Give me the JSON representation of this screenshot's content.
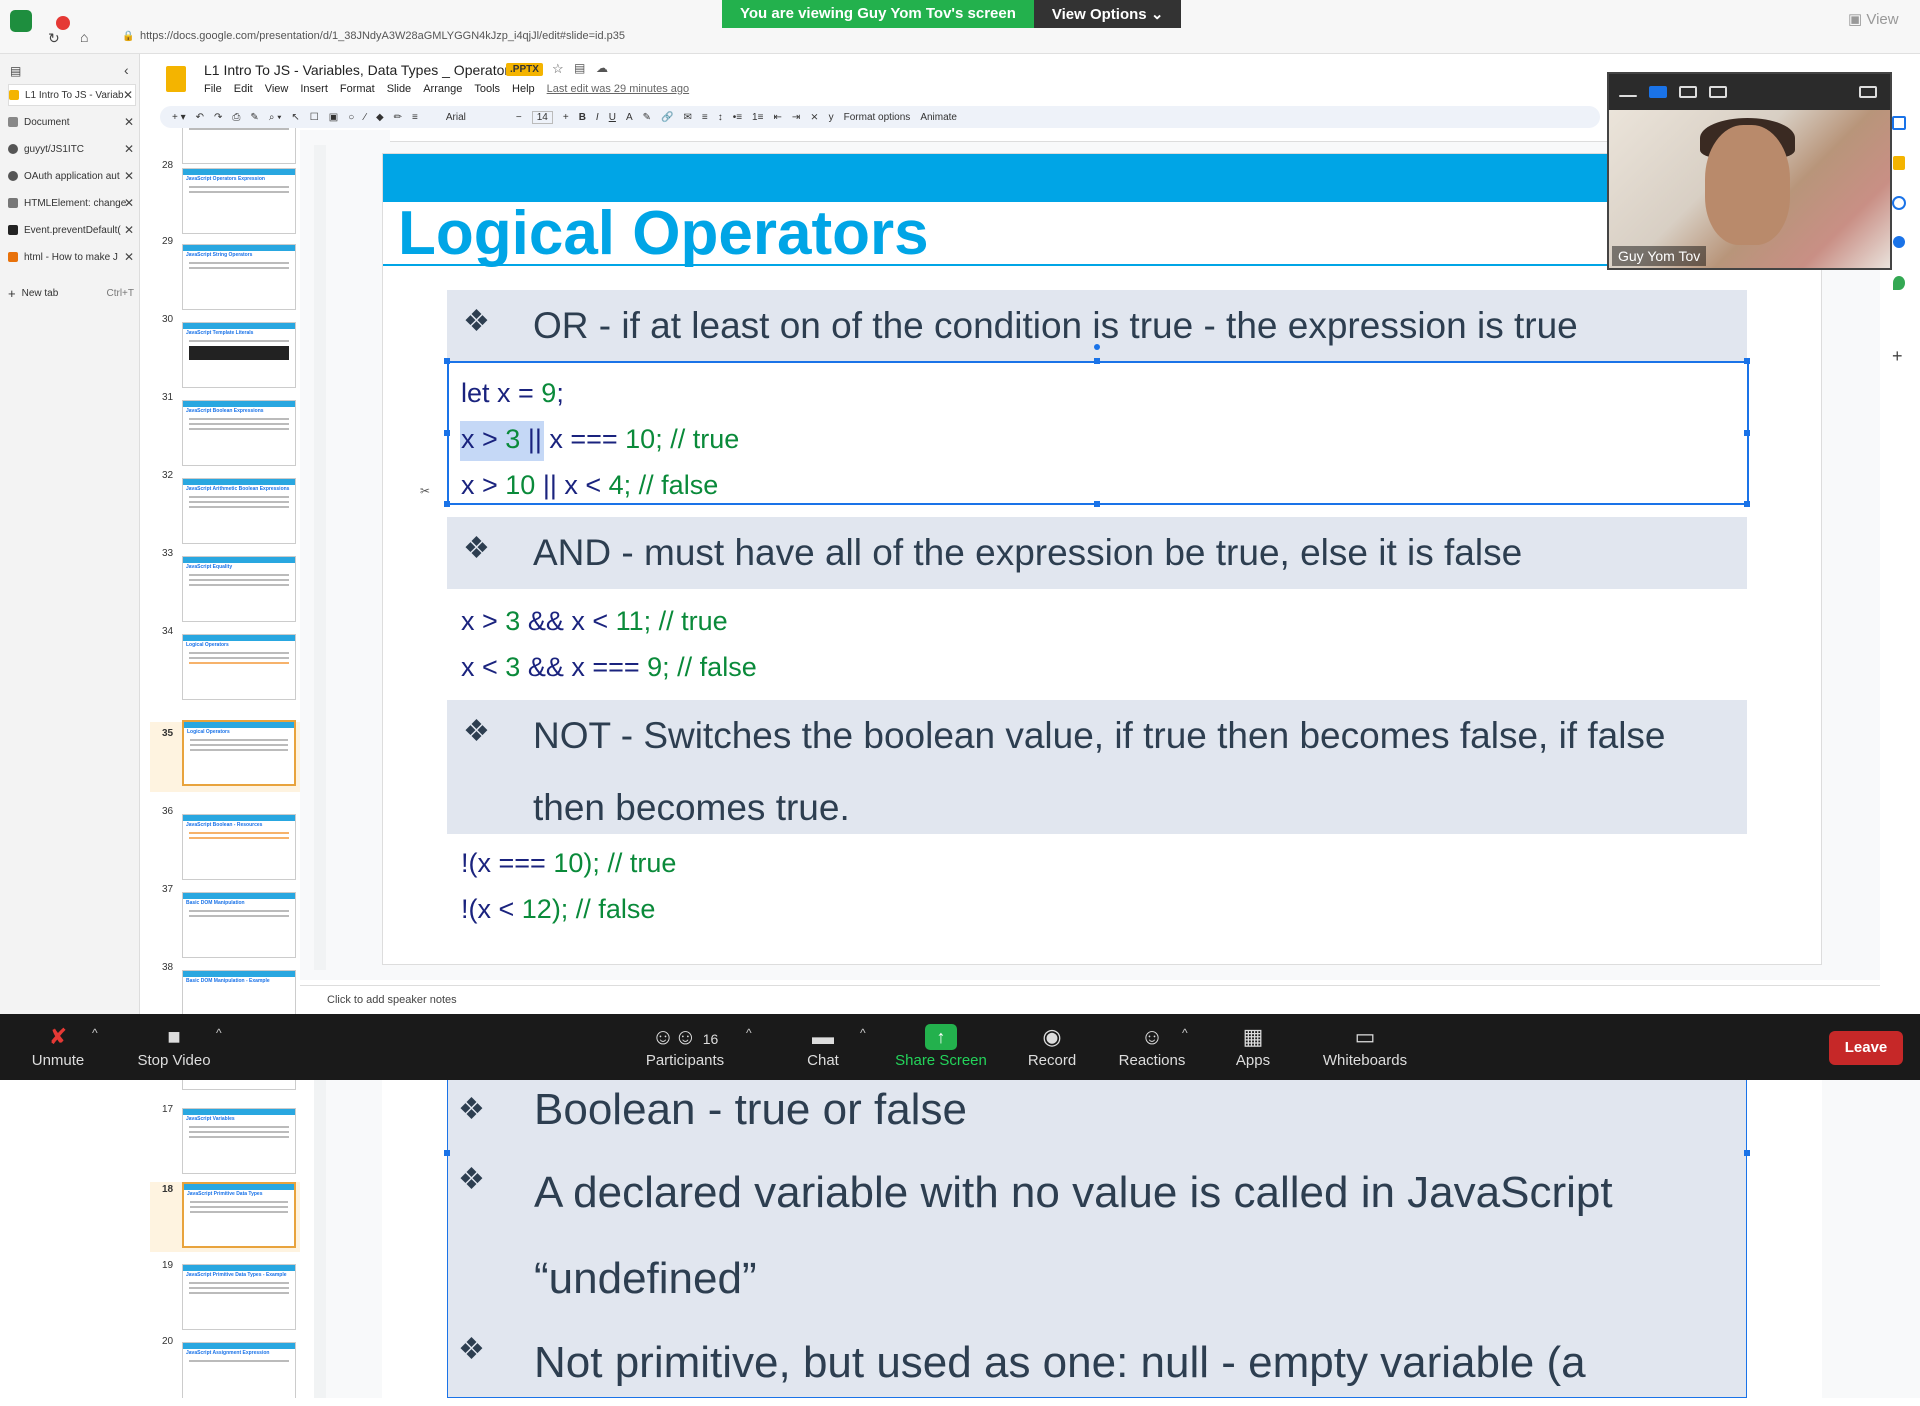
{
  "zoom_banner": {
    "viewing": "You are viewing Guy Yom Tov's screen",
    "view_options": "View Options"
  },
  "browser": {
    "url": "https://docs.google.com/presentation/d/1_38JNdyA3W28aGMLYGGN4kJzp_i4qjJl/edit#slide=id.p35",
    "tabs": [
      {
        "label": "L1 Intro To JS - Variab",
        "color": "#f4b400"
      },
      {
        "label": "Document",
        "color": "#888888"
      },
      {
        "label": "guyyt/JS1ITC",
        "color": "#555555"
      },
      {
        "label": "OAuth application aut",
        "color": "#555555"
      },
      {
        "label": "HTMLElement: change",
        "color": "#777777"
      },
      {
        "label": "Event.preventDefault(",
        "color": "#222222"
      },
      {
        "label": "html - How to make J",
        "color": "#e8710a"
      }
    ],
    "new_tab": "New tab",
    "new_tab_shortcut": "Ctrl+T",
    "view_label": "View"
  },
  "doc": {
    "title": "L1 Intro To JS - Variables, Data Types _ Operators",
    "badge": ".PPTX",
    "menu": [
      "File",
      "Edit",
      "View",
      "Insert",
      "Format",
      "Slide",
      "Arrange",
      "Tools",
      "Help"
    ],
    "last_edit": "Last edit was 29 minutes ago",
    "toolbar": {
      "font": "Arial",
      "size": "14",
      "format_options": "Format options",
      "animate": "Animate"
    }
  },
  "filmstrip": [
    {
      "num": "28",
      "title": "JavaScript Operators Expression"
    },
    {
      "num": "29",
      "title": "JavaScript String Operators"
    },
    {
      "num": "30",
      "title": "JavaScript Template Literals"
    },
    {
      "num": "31",
      "title": "JavaScript Boolean Expressions"
    },
    {
      "num": "32",
      "title": "JavaScript Arithmetic Boolean Expressions"
    },
    {
      "num": "33",
      "title": "JavaScript Equality"
    },
    {
      "num": "34",
      "title": "Logical Operators"
    },
    {
      "num": "35",
      "title": "Logical Operators"
    },
    {
      "num": "36",
      "title": "JavaScript Boolean - Resources"
    },
    {
      "num": "37",
      "title": "Basic DOM Manipulation"
    },
    {
      "num": "38",
      "title": "Basic DOM Manipulation - Example"
    }
  ],
  "slide": {
    "title": "Logical Operators",
    "or_bullet": "OR - if at least on of the condition is true - the expression is true",
    "and_bullet": "AND - must have all of the expression be true, else it is false",
    "not_bullet": "NOT - Switches the boolean value, if true then becomes false, if false then becomes true.",
    "code": {
      "l1": {
        "k": "let x = ",
        "n": "9",
        "p": ";"
      },
      "l2": {
        "a": "x > ",
        "b": "3",
        "c": " || x === ",
        "d": "10",
        "e": "; // true"
      },
      "l3": {
        "a": "x > ",
        "b": "10",
        "c": " || x < ",
        "d": "4",
        "e": "; // false"
      },
      "l4": {
        "a": "x > ",
        "b": "3",
        "c": " && x < ",
        "d": "11",
        "e": "; // true"
      },
      "l5": {
        "a": "x < ",
        "b": "3",
        "c": " && x === ",
        "d": "9",
        "e": "; // false"
      },
      "l6": {
        "a": "!(x === ",
        "b": "10",
        "c": "); // true"
      },
      "l7": {
        "a": "!(x < ",
        "b": "12",
        "c": "); // false"
      }
    }
  },
  "notes_placeholder": "Click to add speaker notes",
  "video": {
    "name": "Guy Yom Tov"
  },
  "zoom_toolbar": {
    "unmute": "Unmute",
    "stop_video": "Stop Video",
    "participants": "Participants",
    "participant_count": "16",
    "chat": "Chat",
    "share_screen": "Share Screen",
    "record": "Record",
    "reactions": "Reactions",
    "apps": "Apps",
    "whiteboards": "Whiteboards",
    "leave": "Leave"
  },
  "lower_filmstrip": [
    {
      "num": "17",
      "title": "JavaScript Variables"
    },
    {
      "num": "18",
      "title": "JavaScript Primitive Data Types"
    },
    {
      "num": "19",
      "title": "JavaScript Primitive Data Types - Example"
    },
    {
      "num": "20",
      "title": "JavaScript Assignment Expression"
    }
  ],
  "lower_slide": {
    "b1": "Boolean - true or false",
    "b2": "A declared variable with no value is called in JavaScript “undefined”",
    "b3": "Not primitive, but used as one: null - empty variable (a"
  }
}
